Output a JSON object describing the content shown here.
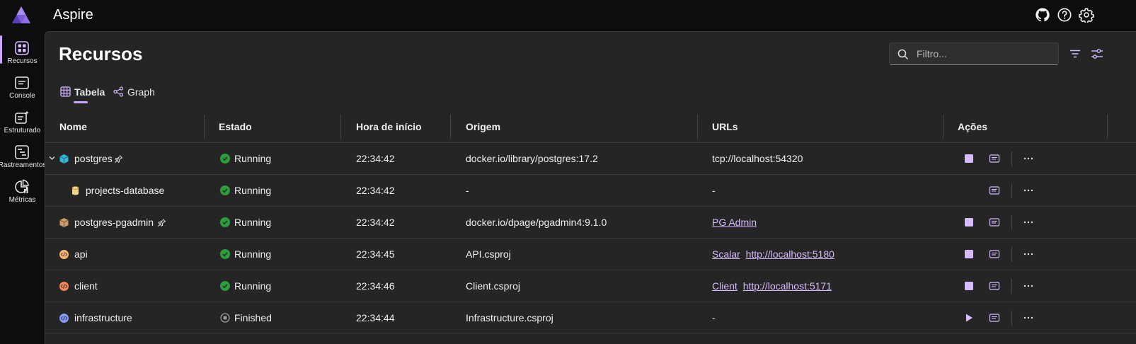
{
  "app": {
    "title": "Aspire"
  },
  "nav": [
    {
      "label": "Recursos",
      "icon": "grid-icon"
    },
    {
      "label": "Console",
      "icon": "console-icon"
    },
    {
      "label": "Estruturado",
      "icon": "structured-logs-icon"
    },
    {
      "label": "Rastreamentos",
      "icon": "traces-icon"
    },
    {
      "label": "Métricas",
      "icon": "metrics-icon"
    }
  ],
  "page": {
    "title": "Recursos"
  },
  "filter": {
    "placeholder": "Filtro..."
  },
  "tabs": [
    {
      "label": "Tabela",
      "selected": true
    },
    {
      "label": "Graph",
      "selected": false
    }
  ],
  "columns": [
    "Nome",
    "Estado",
    "Hora de início",
    "Origem",
    "URLs",
    "Ações"
  ],
  "rows": [
    {
      "name": "postgres",
      "icon": "container-icon",
      "icon_color": "#2fb7d6",
      "pinned": true,
      "expandable": true,
      "state": "Running",
      "start": "22:34:42",
      "source": "docker.io/library/postgres:17.2",
      "urls": [],
      "url_text": "tcp://localhost:54320",
      "action": "stop"
    },
    {
      "name": "projects-database",
      "icon": "database-icon",
      "icon_color": "#f2d48a",
      "child": true,
      "state": "Running",
      "start": "22:34:42",
      "source": "-",
      "urls": [],
      "url_text": "-",
      "action": "none"
    },
    {
      "name": "postgres-pgadmin",
      "icon": "container-icon",
      "icon_color": "#c9a06a",
      "pinned": true,
      "state": "Running",
      "start": "22:34:42",
      "source": "docker.io/dpage/pgadmin4:9.1.0",
      "urls": [
        "PG Admin"
      ],
      "action": "stop"
    },
    {
      "name": "api",
      "icon": "project-icon",
      "icon_color": "#f5b77a",
      "state": "Running",
      "start": "22:34:45",
      "source": "API.csproj",
      "urls": [
        "Scalar",
        "http://localhost:5180"
      ],
      "action": "stop"
    },
    {
      "name": "client",
      "icon": "project-icon",
      "icon_color": "#f08a5d",
      "state": "Running",
      "start": "22:34:46",
      "source": "Client.csproj",
      "urls": [
        "Client",
        "http://localhost:5171"
      ],
      "action": "stop"
    },
    {
      "name": "infrastructure",
      "icon": "project-icon",
      "icon_color": "#8a9cf2",
      "state": "Finished",
      "start": "22:34:44",
      "source": "Infrastructure.csproj",
      "urls": [],
      "url_text": "-",
      "action": "start"
    }
  ],
  "colors": {
    "accent": "#c8a6ff",
    "running": "#2e9b3e",
    "finished": "#9a9a9a"
  }
}
